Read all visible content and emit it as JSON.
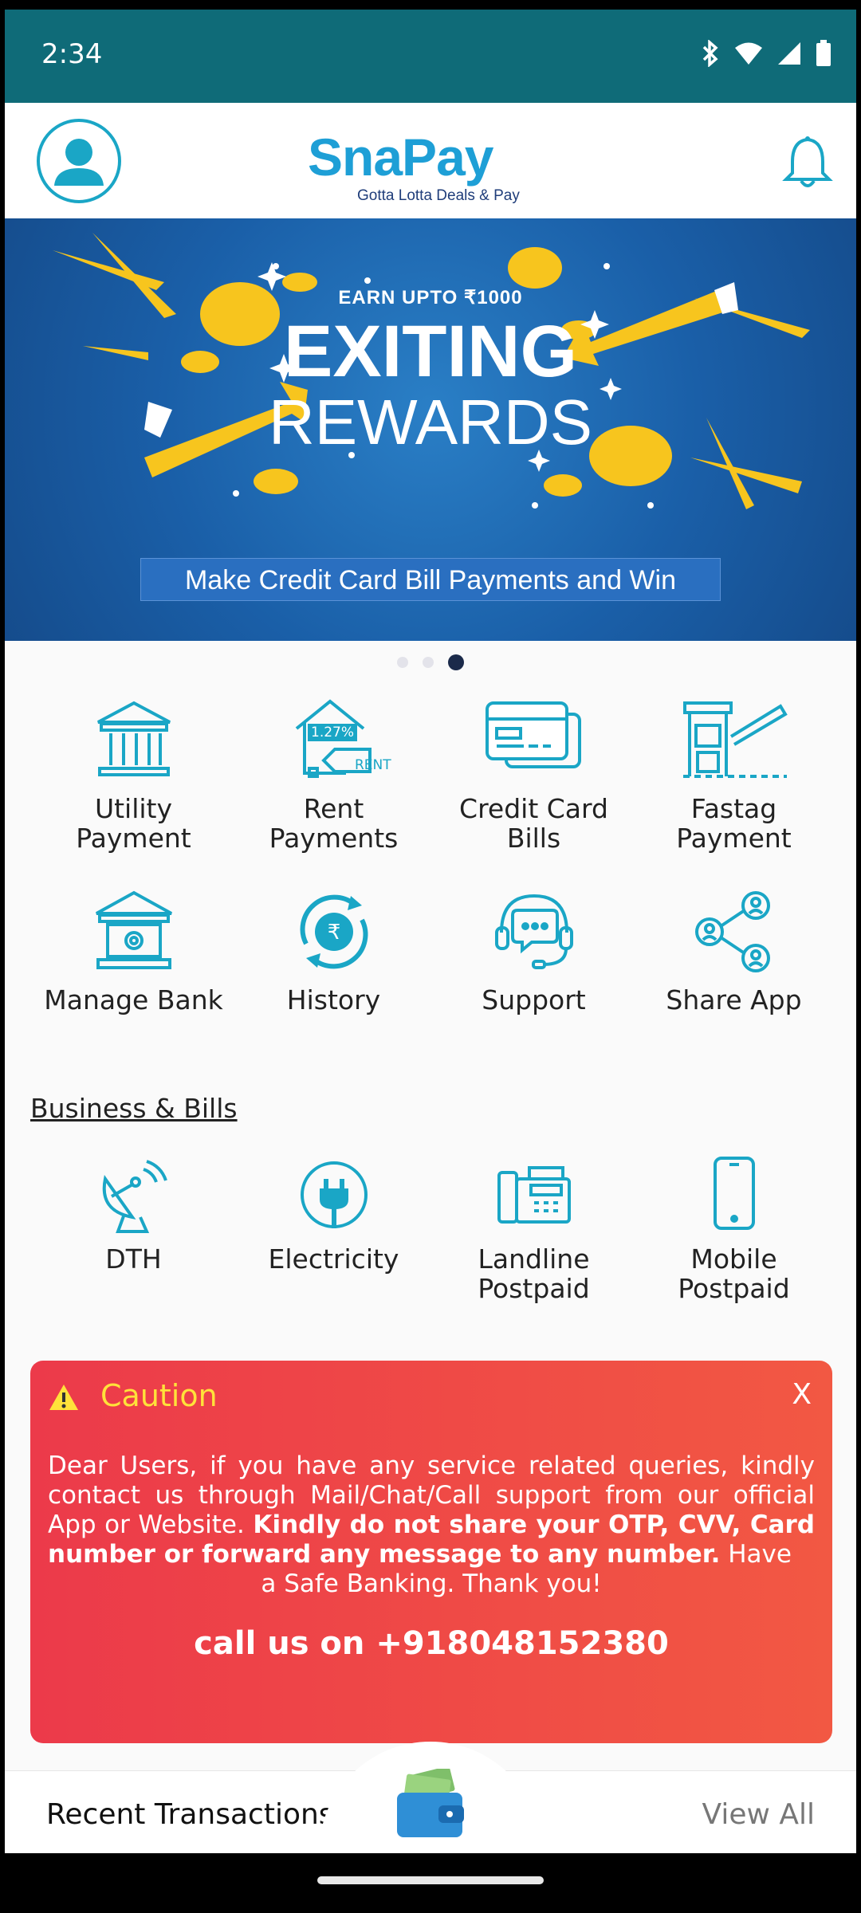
{
  "status_bar": {
    "time": "2:34"
  },
  "header": {
    "logo_text": "SnaPay",
    "logo_tagline": "Gotta Lotta Deals & Pay"
  },
  "banner": {
    "earn": "EARN UPTO ₹1000",
    "title_line1": "EXITING",
    "title_line2": "REWARDS",
    "caption": "Make Credit Card Bill Payments and Win",
    "active_slide": 3,
    "slide_count": 3
  },
  "services": [
    {
      "label": "Utility Payment",
      "icon": "bank-building-icon"
    },
    {
      "label": "Rent Payments",
      "icon": "house-rent-icon",
      "badge": "1.27%",
      "tag": "RENT"
    },
    {
      "label": "Credit Card Bills",
      "icon": "credit-card-icon"
    },
    {
      "label": "Fastag Payment",
      "icon": "toll-gate-icon"
    },
    {
      "label": "Manage Bank",
      "icon": "bank-settings-icon"
    },
    {
      "label": "History",
      "icon": "rupee-history-icon"
    },
    {
      "label": "Support",
      "icon": "headset-chat-icon"
    },
    {
      "label": "Share App",
      "icon": "share-network-icon"
    }
  ],
  "business": {
    "title": "Business & Bills",
    "items": [
      {
        "label": "DTH",
        "icon": "satellite-dish-icon"
      },
      {
        "label": "Electricity",
        "icon": "power-plug-icon"
      },
      {
        "label": "Landline Postpaid",
        "icon": "landline-phone-icon"
      },
      {
        "label": "Mobile Postpaid",
        "icon": "mobile-phone-icon"
      }
    ]
  },
  "caution": {
    "title": "Caution",
    "close": "X",
    "body_part1": "Dear Users, if you have any service related queries, kindly contact us through Mail/Chat/Call support from our official App or Website. ",
    "body_bold": "Kindly do not share your OTP, CVV, Card number or forward any message to any number.",
    "body_part2": " Have",
    "body_last": "a Safe Banking. Thank you!",
    "call": "call us on +918048152380"
  },
  "bottom": {
    "recent": "Recent Transactions",
    "view_all": "View All"
  },
  "colors": {
    "header_bar": "#0f6b78",
    "accent": "#1aa6c6",
    "caution_bg": "#ec3a4a",
    "caution_title": "#ffe23a"
  }
}
